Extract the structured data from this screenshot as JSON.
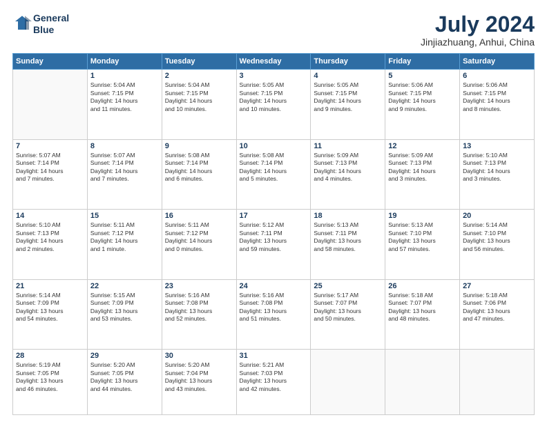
{
  "header": {
    "logo_line1": "General",
    "logo_line2": "Blue",
    "month": "July 2024",
    "location": "Jinjiazhuang, Anhui, China"
  },
  "days_of_week": [
    "Sunday",
    "Monday",
    "Tuesday",
    "Wednesday",
    "Thursday",
    "Friday",
    "Saturday"
  ],
  "weeks": [
    [
      {
        "day": "",
        "info": ""
      },
      {
        "day": "1",
        "info": "Sunrise: 5:04 AM\nSunset: 7:15 PM\nDaylight: 14 hours\nand 11 minutes."
      },
      {
        "day": "2",
        "info": "Sunrise: 5:04 AM\nSunset: 7:15 PM\nDaylight: 14 hours\nand 10 minutes."
      },
      {
        "day": "3",
        "info": "Sunrise: 5:05 AM\nSunset: 7:15 PM\nDaylight: 14 hours\nand 10 minutes."
      },
      {
        "day": "4",
        "info": "Sunrise: 5:05 AM\nSunset: 7:15 PM\nDaylight: 14 hours\nand 9 minutes."
      },
      {
        "day": "5",
        "info": "Sunrise: 5:06 AM\nSunset: 7:15 PM\nDaylight: 14 hours\nand 9 minutes."
      },
      {
        "day": "6",
        "info": "Sunrise: 5:06 AM\nSunset: 7:15 PM\nDaylight: 14 hours\nand 8 minutes."
      }
    ],
    [
      {
        "day": "7",
        "info": "Sunrise: 5:07 AM\nSunset: 7:14 PM\nDaylight: 14 hours\nand 7 minutes."
      },
      {
        "day": "8",
        "info": "Sunrise: 5:07 AM\nSunset: 7:14 PM\nDaylight: 14 hours\nand 7 minutes."
      },
      {
        "day": "9",
        "info": "Sunrise: 5:08 AM\nSunset: 7:14 PM\nDaylight: 14 hours\nand 6 minutes."
      },
      {
        "day": "10",
        "info": "Sunrise: 5:08 AM\nSunset: 7:14 PM\nDaylight: 14 hours\nand 5 minutes."
      },
      {
        "day": "11",
        "info": "Sunrise: 5:09 AM\nSunset: 7:13 PM\nDaylight: 14 hours\nand 4 minutes."
      },
      {
        "day": "12",
        "info": "Sunrise: 5:09 AM\nSunset: 7:13 PM\nDaylight: 14 hours\nand 3 minutes."
      },
      {
        "day": "13",
        "info": "Sunrise: 5:10 AM\nSunset: 7:13 PM\nDaylight: 14 hours\nand 3 minutes."
      }
    ],
    [
      {
        "day": "14",
        "info": "Sunrise: 5:10 AM\nSunset: 7:13 PM\nDaylight: 14 hours\nand 2 minutes."
      },
      {
        "day": "15",
        "info": "Sunrise: 5:11 AM\nSunset: 7:12 PM\nDaylight: 14 hours\nand 1 minute."
      },
      {
        "day": "16",
        "info": "Sunrise: 5:11 AM\nSunset: 7:12 PM\nDaylight: 14 hours\nand 0 minutes."
      },
      {
        "day": "17",
        "info": "Sunrise: 5:12 AM\nSunset: 7:11 PM\nDaylight: 13 hours\nand 59 minutes."
      },
      {
        "day": "18",
        "info": "Sunrise: 5:13 AM\nSunset: 7:11 PM\nDaylight: 13 hours\nand 58 minutes."
      },
      {
        "day": "19",
        "info": "Sunrise: 5:13 AM\nSunset: 7:10 PM\nDaylight: 13 hours\nand 57 minutes."
      },
      {
        "day": "20",
        "info": "Sunrise: 5:14 AM\nSunset: 7:10 PM\nDaylight: 13 hours\nand 56 minutes."
      }
    ],
    [
      {
        "day": "21",
        "info": "Sunrise: 5:14 AM\nSunset: 7:09 PM\nDaylight: 13 hours\nand 54 minutes."
      },
      {
        "day": "22",
        "info": "Sunrise: 5:15 AM\nSunset: 7:09 PM\nDaylight: 13 hours\nand 53 minutes."
      },
      {
        "day": "23",
        "info": "Sunrise: 5:16 AM\nSunset: 7:08 PM\nDaylight: 13 hours\nand 52 minutes."
      },
      {
        "day": "24",
        "info": "Sunrise: 5:16 AM\nSunset: 7:08 PM\nDaylight: 13 hours\nand 51 minutes."
      },
      {
        "day": "25",
        "info": "Sunrise: 5:17 AM\nSunset: 7:07 PM\nDaylight: 13 hours\nand 50 minutes."
      },
      {
        "day": "26",
        "info": "Sunrise: 5:18 AM\nSunset: 7:07 PM\nDaylight: 13 hours\nand 48 minutes."
      },
      {
        "day": "27",
        "info": "Sunrise: 5:18 AM\nSunset: 7:06 PM\nDaylight: 13 hours\nand 47 minutes."
      }
    ],
    [
      {
        "day": "28",
        "info": "Sunrise: 5:19 AM\nSunset: 7:05 PM\nDaylight: 13 hours\nand 46 minutes."
      },
      {
        "day": "29",
        "info": "Sunrise: 5:20 AM\nSunset: 7:05 PM\nDaylight: 13 hours\nand 44 minutes."
      },
      {
        "day": "30",
        "info": "Sunrise: 5:20 AM\nSunset: 7:04 PM\nDaylight: 13 hours\nand 43 minutes."
      },
      {
        "day": "31",
        "info": "Sunrise: 5:21 AM\nSunset: 7:03 PM\nDaylight: 13 hours\nand 42 minutes."
      },
      {
        "day": "",
        "info": ""
      },
      {
        "day": "",
        "info": ""
      },
      {
        "day": "",
        "info": ""
      }
    ]
  ]
}
